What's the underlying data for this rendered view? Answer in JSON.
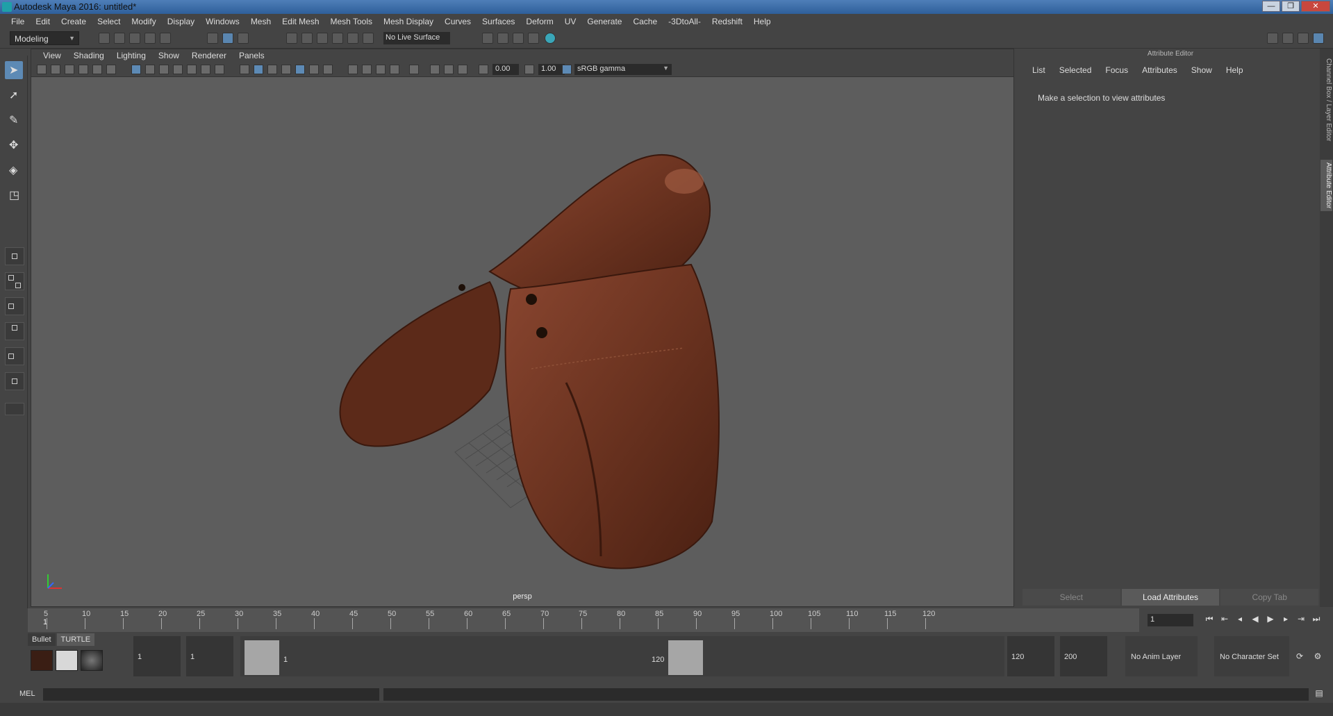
{
  "window": {
    "title": "Autodesk Maya 2016: untitled*",
    "minimize": "—",
    "maximize": "❐",
    "close": "✕"
  },
  "menubar": [
    "File",
    "Edit",
    "Create",
    "Select",
    "Modify",
    "Display",
    "Windows",
    "Mesh",
    "Edit Mesh",
    "Mesh Tools",
    "Mesh Display",
    "Curves",
    "Surfaces",
    "Deform",
    "UV",
    "Generate",
    "Cache",
    "-3DtoAll-",
    "Redshift",
    "Help"
  ],
  "toolbar": {
    "mode": "Modeling",
    "live_surface": "No Live Surface"
  },
  "viewport": {
    "menus": [
      "View",
      "Shading",
      "Lighting",
      "Show",
      "Renderer",
      "Panels"
    ],
    "exposure": "0.00",
    "gamma_value": "1.00",
    "color_space": "sRGB gamma",
    "camera_label": "persp"
  },
  "attribute_editor": {
    "title": "Attribute Editor",
    "menus": [
      "List",
      "Selected",
      "Focus",
      "Attributes",
      "Show",
      "Help"
    ],
    "message": "Make a selection to view attributes",
    "buttons": [
      "Select",
      "Load Attributes",
      "Copy Tab"
    ]
  },
  "side_tabs": [
    "Channel Box / Layer Editor",
    "Attribute Editor"
  ],
  "timeline": {
    "ticks": [
      "5",
      "10",
      "15",
      "20",
      "25",
      "30",
      "35",
      "40",
      "45",
      "50",
      "55",
      "60",
      "65",
      "70",
      "75",
      "80",
      "85",
      "90",
      "95",
      "100",
      "105",
      "110",
      "115",
      "120"
    ],
    "current_frame_marker": "1",
    "current_frame": "1"
  },
  "range": {
    "shelf_tabs": [
      "Bullet",
      "TURTLE"
    ],
    "start_time": "1",
    "playback_start": "1",
    "slider_start": "1",
    "slider_end": "120",
    "playback_end": "120",
    "end_time": "200",
    "anim_layer": "No Anim Layer",
    "character_set": "No Character Set"
  },
  "command": {
    "label": "MEL"
  },
  "colors": {
    "saddle": "#6b3320",
    "viewport_bg": "#5d5d5d",
    "accent": "#5d8ab5"
  }
}
